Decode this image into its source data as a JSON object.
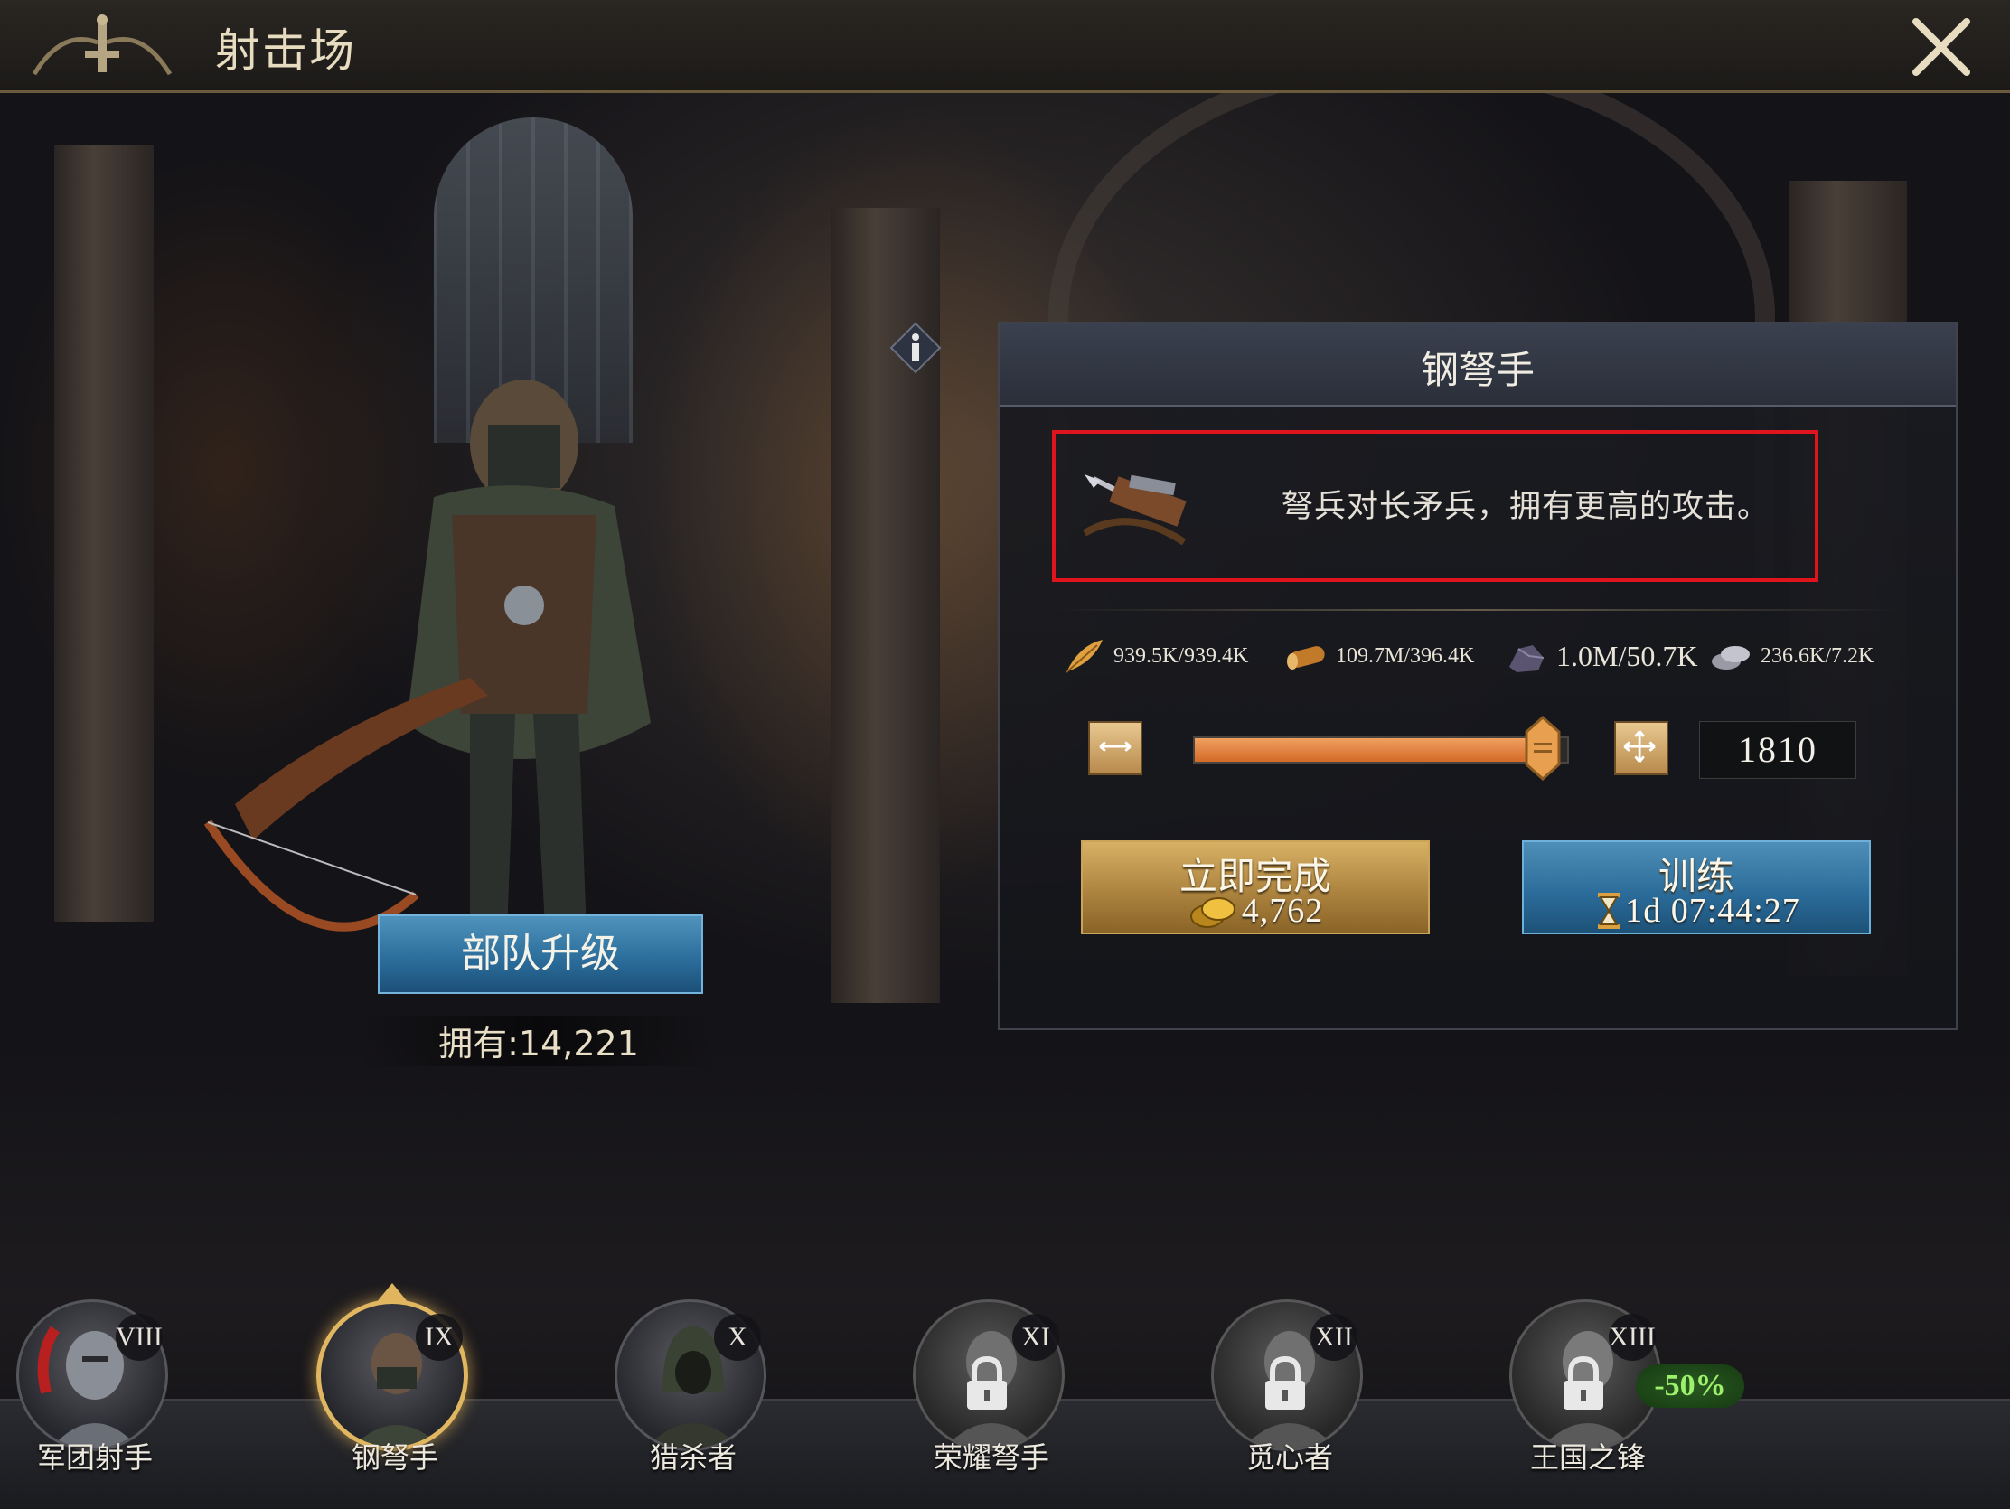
{
  "header": {
    "title": "射击场"
  },
  "unit_detail": {
    "name": "钢弩手",
    "description": "弩兵对长矛兵，拥有更高的攻击。",
    "resources": [
      {
        "icon": "feather-icon",
        "value": "939.5K/939.4K"
      },
      {
        "icon": "wood-log-icon",
        "value": "109.7M/396.4K"
      },
      {
        "icon": "iron-ore-icon",
        "value": "1.0M/50.7K"
      },
      {
        "icon": "silver-coins-icon",
        "value": "236.6K/7.2K"
      }
    ],
    "train_count": "1810",
    "train_fraction": 0.94,
    "instant": {
      "label": "立即完成",
      "cost": "4,762"
    },
    "train": {
      "label": "训练",
      "time": "1d 07:44:27"
    }
  },
  "upgrade_label": "部队升级",
  "owned": {
    "label": "拥有:",
    "value": "14,221"
  },
  "units": [
    {
      "name": "军团射手",
      "rank": "VIII",
      "locked": false,
      "selected": false
    },
    {
      "name": "钢弩手",
      "rank": "IX",
      "locked": false,
      "selected": true
    },
    {
      "name": "猎杀者",
      "rank": "X",
      "locked": false,
      "selected": false
    },
    {
      "name": "荣耀弩手",
      "rank": "XI",
      "locked": true,
      "selected": false
    },
    {
      "name": "觅心者",
      "rank": "XII",
      "locked": true,
      "selected": false
    },
    {
      "name": "王国之锋",
      "rank": "XIII",
      "locked": true,
      "selected": false,
      "badge": "-50%"
    }
  ],
  "colors": {
    "accent_gold": "#d8b064",
    "accent_blue": "#2a6a98",
    "highlight_red": "#e0141c",
    "discount_green": "#9cf06a"
  }
}
